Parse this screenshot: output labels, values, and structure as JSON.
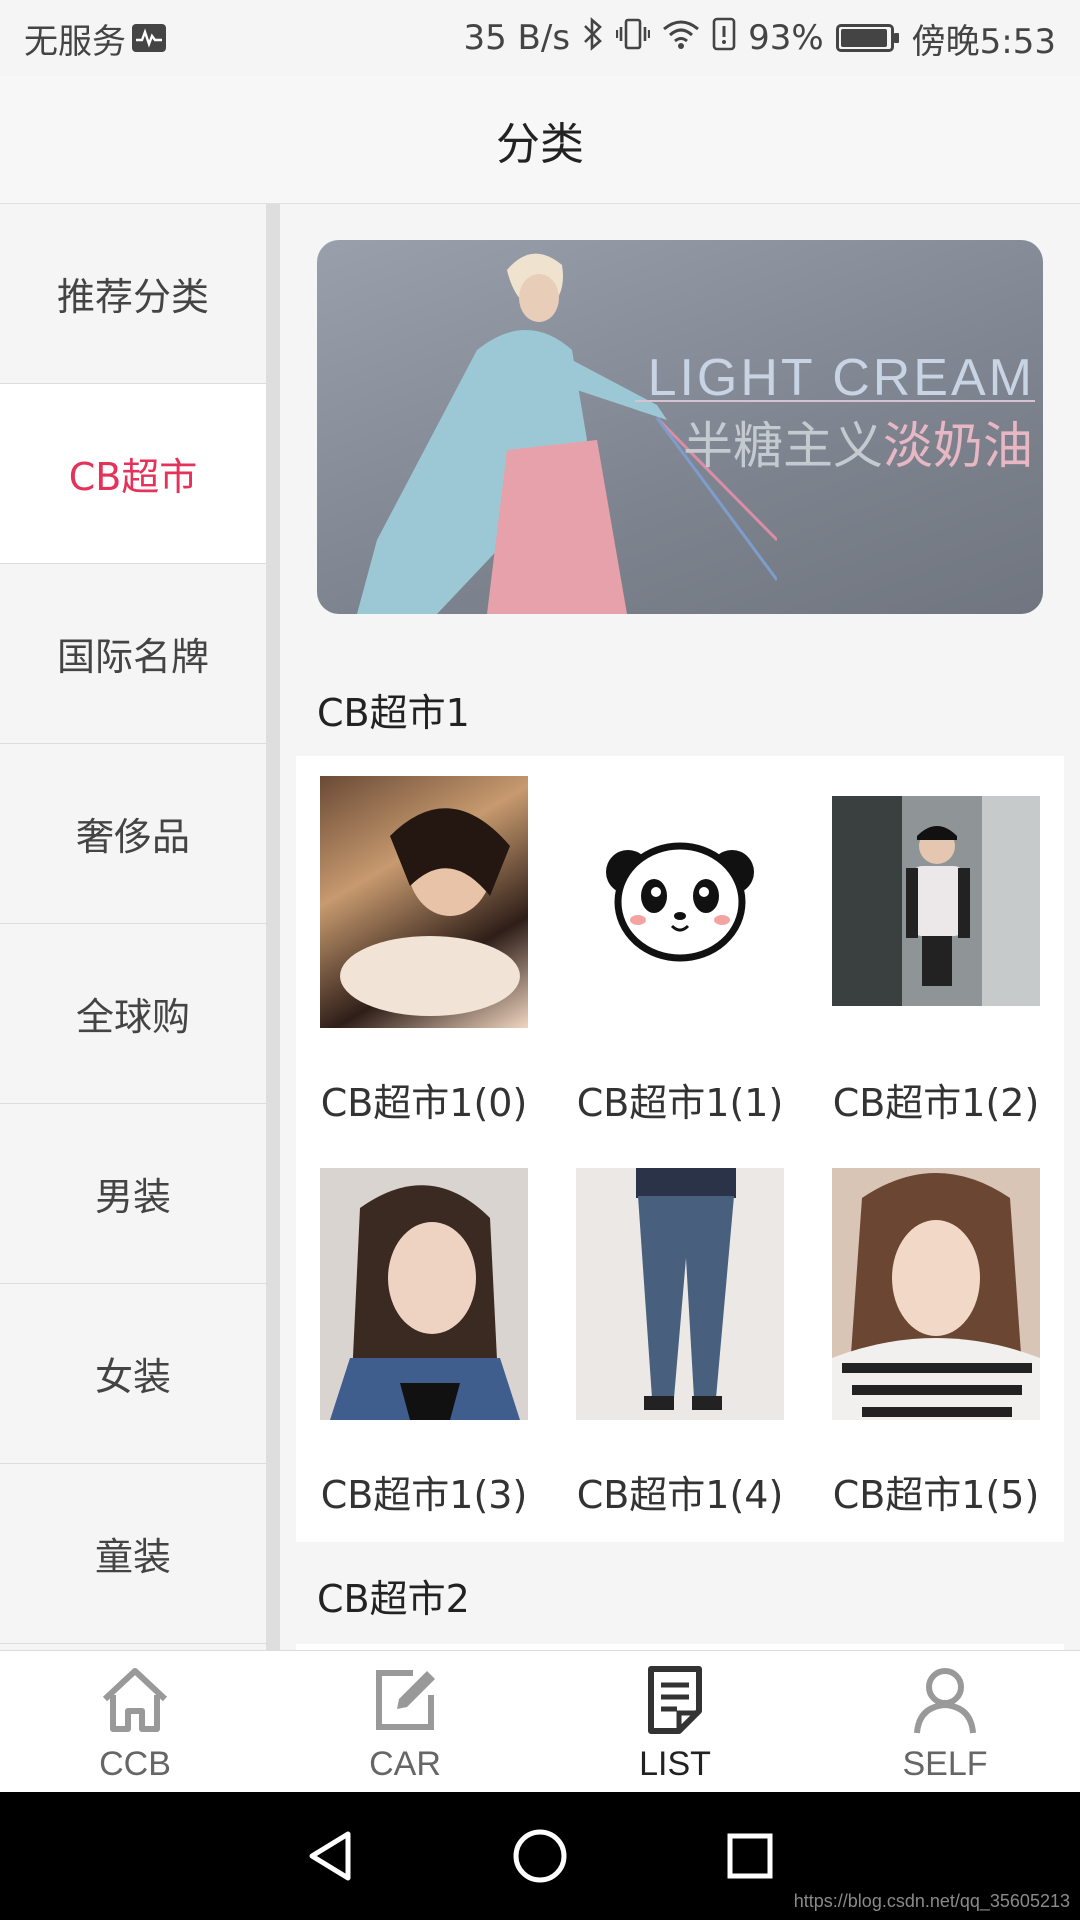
{
  "status_bar": {
    "carrier": "无服务",
    "net_speed": "35 B/s",
    "battery": "93%",
    "time": "傍晚5:53",
    "icons": [
      "monitor-icon",
      "bluetooth-icon",
      "vibrate-icon",
      "wifi-icon",
      "alert-icon",
      "battery-icon"
    ]
  },
  "header": {
    "title": "分类"
  },
  "sidebar": {
    "items": [
      {
        "label": "推荐分类"
      },
      {
        "label": "CB超市"
      },
      {
        "label": "国际名牌"
      },
      {
        "label": "奢侈品"
      },
      {
        "label": "全球购"
      },
      {
        "label": "男装"
      },
      {
        "label": "女装"
      },
      {
        "label": "童装"
      }
    ],
    "active_index": 1
  },
  "banner": {
    "title_en": "LIGHT CREAM",
    "title_cn_a": "半糖主义",
    "title_cn_b": "淡奶油"
  },
  "sections": [
    {
      "title": "CB超市1",
      "items": [
        {
          "label": "CB超市1(0)",
          "image": "photo-woman-lying"
        },
        {
          "label": "CB超市1(1)",
          "image": "panda-icon"
        },
        {
          "label": "CB超市1(2)",
          "image": "photo-woman-cap"
        },
        {
          "label": "CB超市1(3)",
          "image": "photo-woman-denim"
        },
        {
          "label": "CB超市1(4)",
          "image": "photo-jeans"
        },
        {
          "label": "CB超市1(5)",
          "image": "photo-woman-sweater"
        }
      ]
    },
    {
      "title": "CB超市2"
    }
  ],
  "bottom_nav": {
    "items": [
      {
        "label": "CCB",
        "icon": "home-icon"
      },
      {
        "label": "CAR",
        "icon": "edit-icon"
      },
      {
        "label": "LIST",
        "icon": "list-icon"
      },
      {
        "label": "SELF",
        "icon": "user-icon"
      }
    ],
    "active_index": 2
  },
  "watermark": "https://blog.csdn.net/qq_35605213",
  "colors": {
    "accent": "#e5325a",
    "sidebar_bg": "#f5f5f5",
    "card_bg": "#ffffff"
  }
}
